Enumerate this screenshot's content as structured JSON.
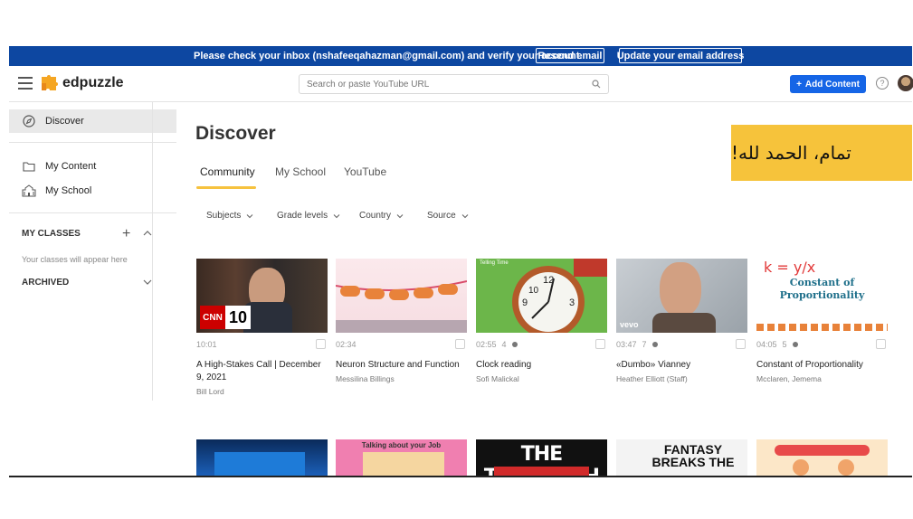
{
  "banner": {
    "message": "Please check your inbox (nshafeeqahazman@gmail.com) and verify your account.",
    "resend_label": "Resend email",
    "update_label": "Update your email address"
  },
  "topbar": {
    "logo_text": "edpuzzle",
    "search_placeholder": "Search or paste YouTube URL",
    "add_content_label": "Add Content",
    "help_symbol": "?"
  },
  "sidebar": {
    "items": [
      {
        "label": "Discover",
        "icon": "compass-icon"
      },
      {
        "label": "My Content",
        "icon": "folder-icon"
      },
      {
        "label": "My School",
        "icon": "school-icon"
      }
    ],
    "classes_heading": "MY CLASSES",
    "classes_empty": "Your classes will appear here",
    "archived_heading": "ARCHIVED"
  },
  "main": {
    "title": "Discover",
    "tabs": [
      {
        "label": "Community",
        "active": true
      },
      {
        "label": "My School",
        "active": false
      },
      {
        "label": "YouTube",
        "active": false
      }
    ],
    "filters": [
      "Subjects",
      "Grade levels",
      "Country",
      "Source"
    ]
  },
  "overlay": {
    "arabic_text": "تمام، الحمد لله!",
    "color": "#f6c33b"
  },
  "cards": [
    {
      "duration": "10:01",
      "questions": "",
      "title": "A High-Stakes Call | December 9, 2021",
      "author": "Bill Lord",
      "thumb_text": "10"
    },
    {
      "duration": "02:34",
      "questions": "",
      "title": "Neuron Structure and Function",
      "author": "Messilina Billings",
      "thumb_text": ""
    },
    {
      "duration": "02:55",
      "questions": "4",
      "title": "Clock reading",
      "author": "Sofi Malickal",
      "thumb_text": "Telling Time"
    },
    {
      "duration": "03:47",
      "questions": "7",
      "title": "«Dumbo» Vianney",
      "author": "Heather Elliott (Staff)",
      "thumb_text": "vevo"
    },
    {
      "duration": "04:05",
      "questions": "5",
      "title": "Constant of Proportionality",
      "author": "Mcclaren, Jemema",
      "thumb_text": "Constant of Proportionality"
    }
  ],
  "cards_row2": [
    {
      "thumb_text": ""
    },
    {
      "thumb_text": "Talking about your Job"
    },
    {
      "thumb_text": "THE TECUMSEH"
    },
    {
      "thumb_text": "FANTASY BREAKS THE"
    },
    {
      "thumb_text": ""
    }
  ],
  "colors": {
    "banner": "#0d47a1",
    "accent": "#1565e6",
    "tab_underline": "#f6c23e"
  }
}
